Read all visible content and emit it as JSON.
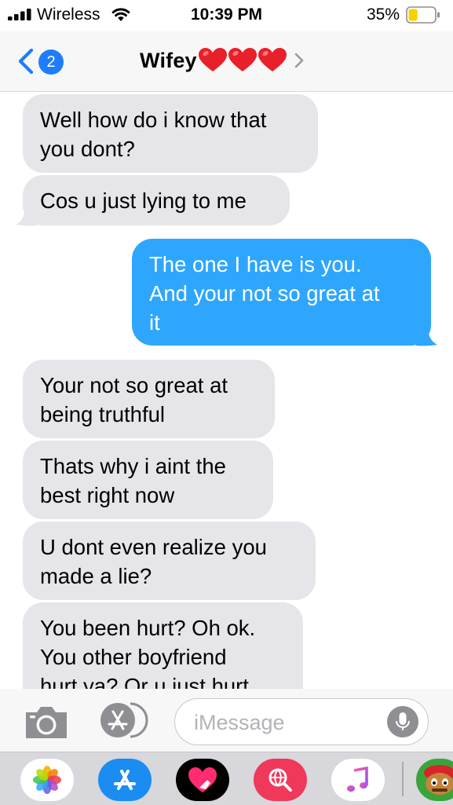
{
  "status_bar": {
    "carrier": "Wireless",
    "time": "10:39 PM",
    "battery_percent": "35%",
    "battery_level": 0.35,
    "signal_bars": 4,
    "icons": [
      "signal-icon",
      "wifi-icon",
      "battery-icon"
    ]
  },
  "nav": {
    "unread_count": "2",
    "contact_name": "Wifey",
    "contact_emoji": "❤️❤️❤️",
    "icons": [
      "back-chevron-icon",
      "heart-icon",
      "chevron-right-icon"
    ]
  },
  "messages": [
    {
      "direction": "incoming",
      "lines": [
        "Well how do i know that",
        "you dont?"
      ]
    },
    {
      "direction": "incoming",
      "lines": [
        "Cos u just lying to me"
      ]
    },
    {
      "direction": "outgoing",
      "lines": [
        "The one I have is you.",
        "And your not so great at",
        "it"
      ]
    },
    {
      "direction": "incoming",
      "lines": [
        "Your not so great at",
        "being truthful"
      ]
    },
    {
      "direction": "incoming",
      "lines": [
        "Thats why i aint the",
        "best right now"
      ]
    },
    {
      "direction": "incoming",
      "lines": [
        "U dont even realize you",
        "made a lie?"
      ]
    },
    {
      "direction": "incoming",
      "lines": [
        "You been hurt? Oh ok.",
        "You other boyfriend",
        "hurt ya? Or u just hurt"
      ]
    }
  ],
  "compose": {
    "placeholder": "iMessage",
    "value": "",
    "icons": [
      "camera-icon",
      "app-store-icon",
      "microphone-icon"
    ]
  },
  "app_drawer": {
    "apps": [
      {
        "name": "photos-app-icon",
        "bg": "#ffffff"
      },
      {
        "name": "app-store-app-icon",
        "bg": "#1a8cf2"
      },
      {
        "name": "digital-touch-app-icon",
        "bg": "#000000"
      },
      {
        "name": "web-images-app-icon",
        "bg": "#f0385a"
      },
      {
        "name": "music-app-icon",
        "bg": "#ffffff"
      },
      {
        "name": "animoji-app-icon",
        "bg": "#3aa43a"
      }
    ]
  },
  "colors": {
    "incoming_bubble": "#e5e5ea",
    "outgoing_bubble": "#2ea6fd",
    "ios_blue": "#1f7dfb",
    "heart_red": "#e8202a"
  }
}
